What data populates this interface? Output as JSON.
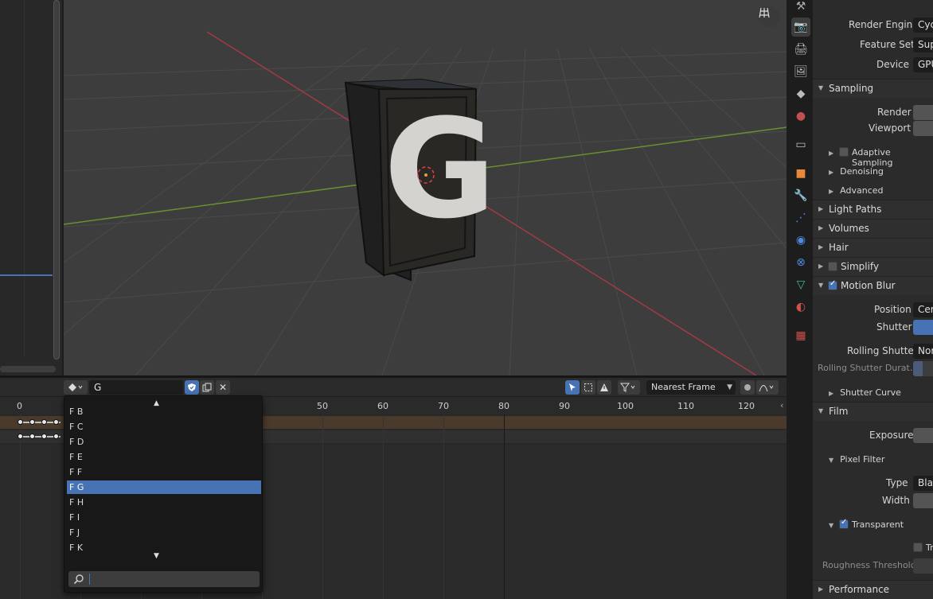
{
  "viewport": {
    "letter": "G"
  },
  "timeline": {
    "search_value": "G",
    "snap_mode": "Nearest Frame",
    "ruler_labels": [
      "0",
      "50",
      "60",
      "70",
      "80",
      "90",
      "100",
      "110",
      "120"
    ]
  },
  "popup": {
    "items": [
      "F B",
      "F C",
      "F D",
      "F E",
      "F F",
      "F G",
      "F H",
      "F I",
      "F J",
      "F K"
    ],
    "selected": "F G"
  },
  "properties": {
    "render_engine_label": "Render Engine",
    "render_engine_value": "Cyc",
    "feature_set_label": "Feature Set",
    "feature_set_value": "Sup",
    "device_label": "Device",
    "device_value": "GPU",
    "sampling": "Sampling",
    "render_label": "Render",
    "viewport_label": "Viewport",
    "adaptive_sampling": "Adaptive Sampling",
    "denoising": "Denoising",
    "advanced": "Advanced",
    "light_paths": "Light Paths",
    "volumes": "Volumes",
    "hair": "Hair",
    "simplify": "Simplify",
    "motion_blur": "Motion Blur",
    "position_label": "Position",
    "position_value": "Cer",
    "shutter_label": "Shutter",
    "rolling_shutter_label": "Rolling Shutter",
    "rolling_shutter_value": "Nor",
    "rolling_shutter_duration": "Rolling Shutter Durat...",
    "shutter_curve": "Shutter Curve",
    "film": "Film",
    "exposure_label": "Exposure",
    "pixel_filter": "Pixel Filter",
    "type_label": "Type",
    "type_value": "Bla",
    "width_label": "Width",
    "transparent": "Transparent",
    "transparent_glass": "Tr",
    "roughness_threshold": "Roughness Threshold",
    "performance": "Performance"
  },
  "colors": {
    "accent": "#4772b3",
    "x_axis": "#a23a45",
    "y_axis": "#6b8f2e",
    "keyframe_row": "#4a3a2c"
  }
}
